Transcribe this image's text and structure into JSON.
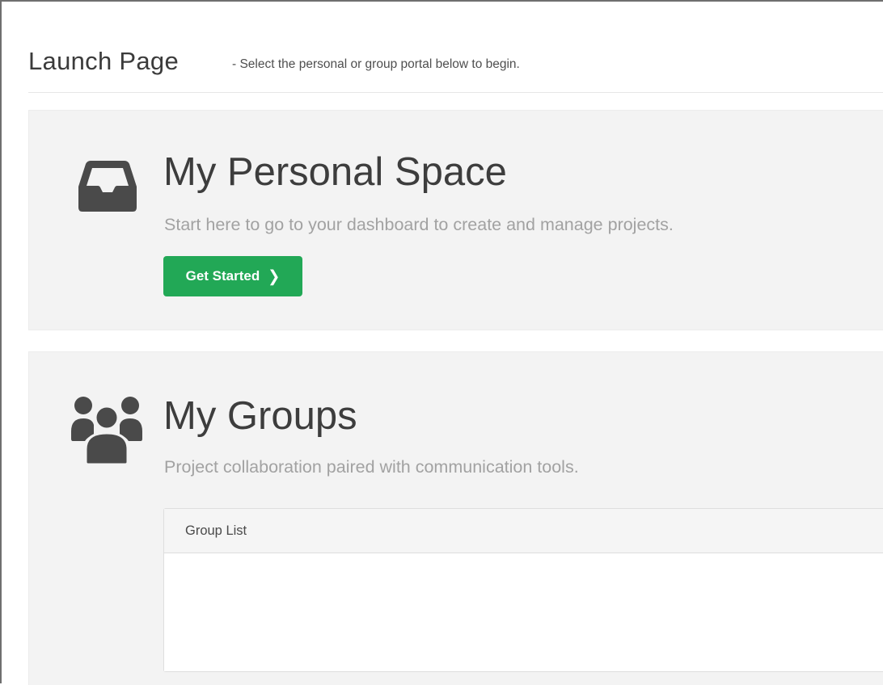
{
  "header": {
    "title": "Launch Page",
    "subtitle": "- Select the personal or group portal below to begin."
  },
  "personal": {
    "icon": "inbox-tray-icon",
    "title": "My Personal Space",
    "description": "Start here to go to your dashboard to create and manage projects.",
    "button_label": "Get Started",
    "button_icon": "chevron-right-icon",
    "button_color": "#22a856"
  },
  "groups": {
    "icon": "users-group-icon",
    "title": "My Groups",
    "description": "Project collaboration paired with communication tools.",
    "list_header": "Group List",
    "items": []
  },
  "colors": {
    "panel_bg": "#f3f3f3",
    "icon": "#4a4a4a",
    "accent": "#22a856"
  }
}
